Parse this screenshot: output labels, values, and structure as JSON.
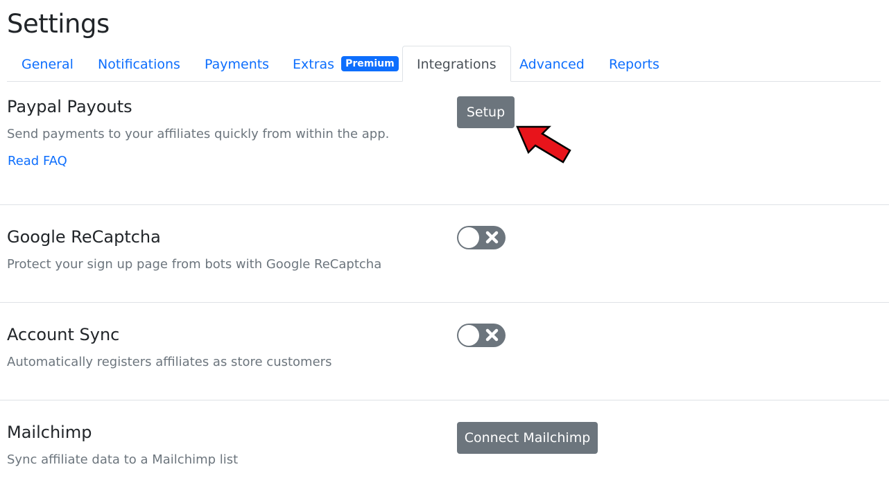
{
  "page": {
    "title": "Settings"
  },
  "tabs": [
    {
      "label": "General",
      "active": false
    },
    {
      "label": "Notifications",
      "active": false
    },
    {
      "label": "Payments",
      "active": false
    },
    {
      "label": "Extras",
      "active": false,
      "badge": "Premium"
    },
    {
      "label": "Integrations",
      "active": true
    },
    {
      "label": "Advanced",
      "active": false
    },
    {
      "label": "Reports",
      "active": false
    }
  ],
  "integrations": {
    "paypal": {
      "title": "Paypal Payouts",
      "description": "Send payments to your affiliates quickly from within the app.",
      "link_label": "Read FAQ",
      "button_label": "Setup"
    },
    "recaptcha": {
      "title": "Google ReCaptcha",
      "description": "Protect your sign up page from bots with Google ReCaptcha",
      "enabled": false
    },
    "account_sync": {
      "title": "Account Sync",
      "description": "Automatically registers affiliates as store customers",
      "enabled": false
    },
    "mailchimp": {
      "title": "Mailchimp",
      "description": "Sync affiliate data to a Mailchimp list",
      "button_label": "Connect Mailchimp"
    }
  },
  "icons": {
    "toggle_off": "close-icon",
    "annotation": "arrow-pointer-icon"
  },
  "colors": {
    "link": "#0d6efd",
    "badge": "#0d6efd",
    "button": "#6c757d",
    "toggle_off": "#6c757d",
    "annotation_arrow": "#e8141b"
  }
}
